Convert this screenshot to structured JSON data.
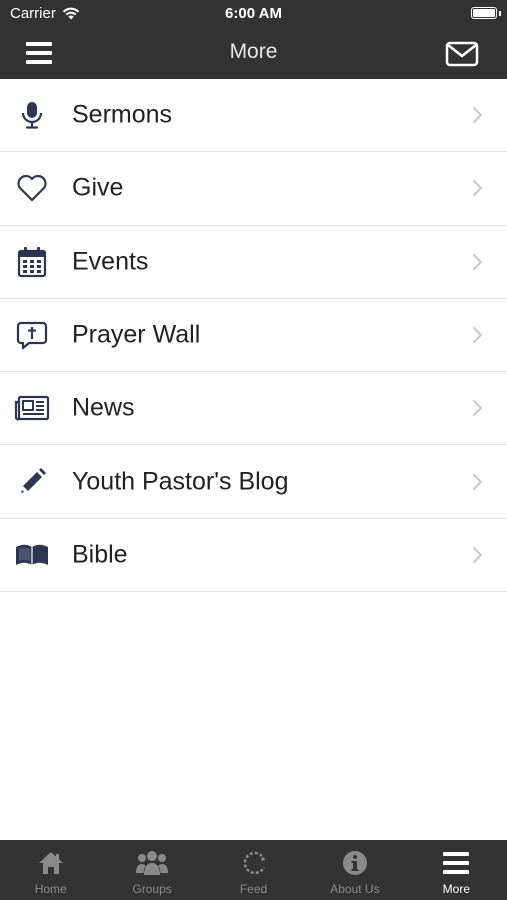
{
  "status_bar": {
    "carrier": "Carrier",
    "time": "6:00 AM"
  },
  "header": {
    "title": "More",
    "menu_icon": "hamburger-icon",
    "mail_icon": "mail-icon"
  },
  "menu_items": [
    {
      "label": "Sermons",
      "icon": "microphone-icon"
    },
    {
      "label": "Give",
      "icon": "heart-icon"
    },
    {
      "label": "Events",
      "icon": "calendar-icon"
    },
    {
      "label": "Prayer Wall",
      "icon": "prayer-bubble-icon"
    },
    {
      "label": "News",
      "icon": "newspaper-icon"
    },
    {
      "label": "Youth Pastor's Blog",
      "icon": "pencil-icon"
    },
    {
      "label": "Bible",
      "icon": "book-icon"
    }
  ],
  "tab_bar": [
    {
      "label": "Home",
      "icon": "home-icon",
      "active": false
    },
    {
      "label": "Groups",
      "icon": "groups-icon",
      "active": false
    },
    {
      "label": "Feed",
      "icon": "feed-icon",
      "active": false
    },
    {
      "label": "About Us",
      "icon": "info-icon",
      "active": false
    },
    {
      "label": "More",
      "icon": "more-icon",
      "active": true
    }
  ],
  "colors": {
    "header_bg": "#333333",
    "icon": "#2d3650",
    "chevron": "#c7c7cc",
    "tab_inactive": "#8a8a8a",
    "tab_active": "#ffffff"
  }
}
